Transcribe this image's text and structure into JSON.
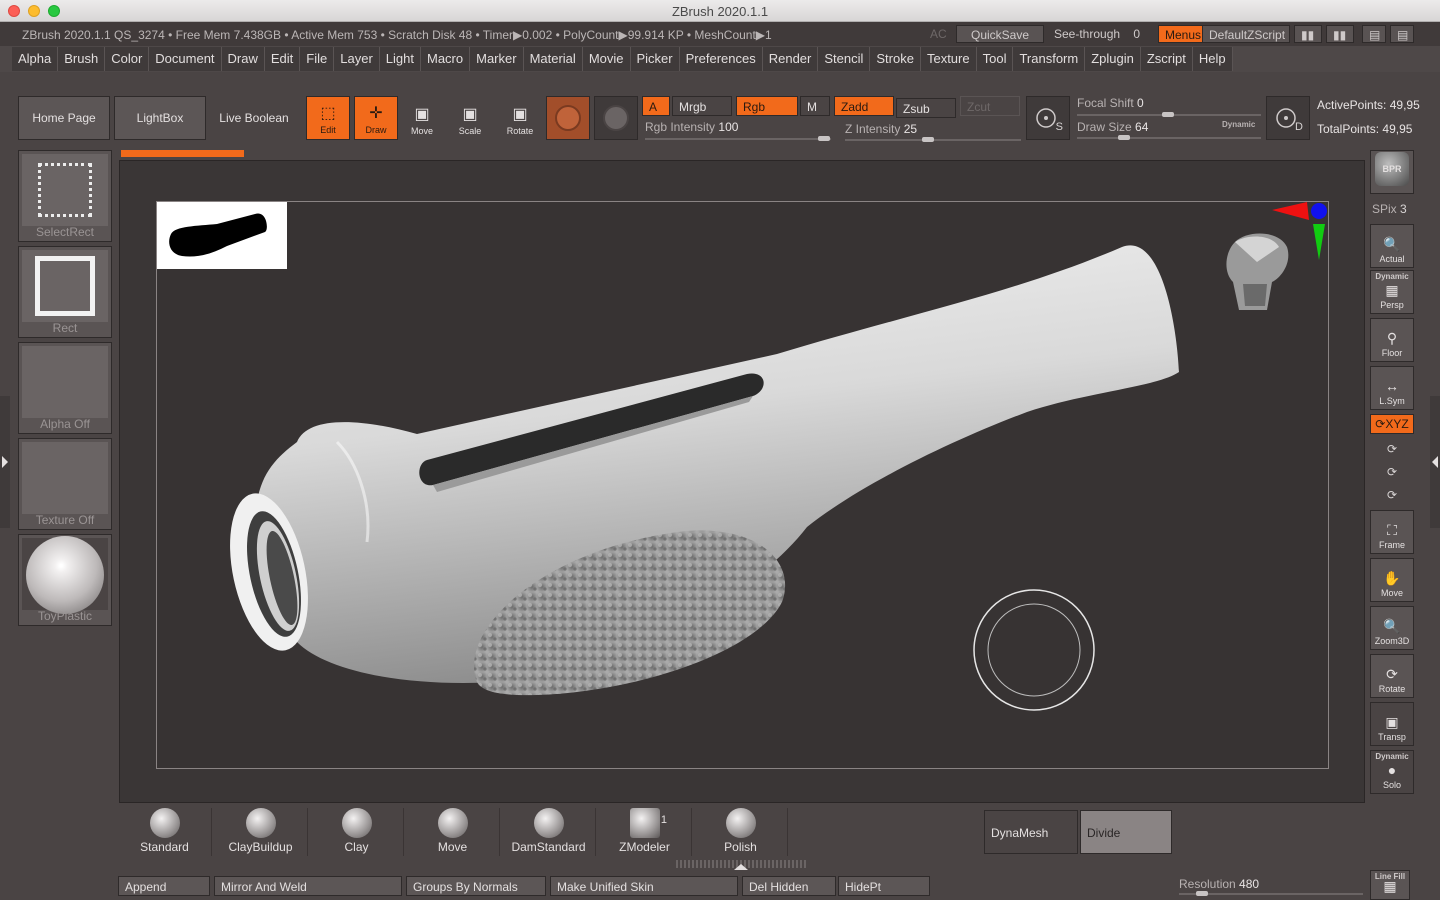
{
  "window": {
    "title": "ZBrush 2020.1.1"
  },
  "infobar": {
    "text": "ZBrush 2020.1.1 QS_3274     • Free Mem 7.438GB • Active Mem 753 • Scratch Disk 48 •   Timer▶0.002 • PolyCount▶99.914 KP  • MeshCount▶1",
    "ac_label": "AC",
    "quicksave": "QuickSave",
    "seethrough_label": "See-through",
    "seethrough_value": "0",
    "menus": "Menus",
    "defaultzscript": "DefaultZScript"
  },
  "menubar": [
    "Alpha",
    "Brush",
    "Color",
    "Document",
    "Draw",
    "Edit",
    "File",
    "Layer",
    "Light",
    "Macro",
    "Marker",
    "Material",
    "Movie",
    "Picker",
    "Preferences",
    "Render",
    "Stencil",
    "Stroke",
    "Texture",
    "Tool",
    "Transform",
    "Zplugin",
    "Zscript",
    "Help"
  ],
  "shelf": {
    "home_page": "Home Page",
    "lightbox": "LightBox",
    "live_boolean": "Live Boolean",
    "edit": "Edit",
    "draw": "Draw",
    "move": "Move",
    "scale": "Scale",
    "rotate": "Rotate",
    "a": "A",
    "mrgb": "Mrgb",
    "rgb": "Rgb",
    "m": "M",
    "zadd": "Zadd",
    "zsub": "Zsub",
    "zcut": "Zcut",
    "rgb_intensity_label": "Rgb Intensity",
    "rgb_intensity_value": "100",
    "z_intensity_label": "Z Intensity",
    "z_intensity_value": "25",
    "focal_shift_label": "Focal Shift",
    "focal_shift_value": "0",
    "draw_size_label": "Draw Size",
    "draw_size_value": "64",
    "dynamic": "Dynamic",
    "active_points_label": "ActivePoints:",
    "active_points_value": "49,95",
    "total_points_label": "TotalPoints:",
    "total_points_value": "49,95",
    "s_letter": "S",
    "d_letter": "D"
  },
  "left_panel": [
    "SelectRect",
    "Rect",
    "Alpha Off",
    "Texture Off",
    "ToyPlastic"
  ],
  "right_panel": {
    "bpr": "BPR",
    "spix_label": "SPix",
    "spix_value": "3",
    "actual": "Actual",
    "persp": "Persp",
    "dynamic": "Dynamic",
    "floor": "Floor",
    "lsym": "L.Sym",
    "xyz": "XYZ",
    "frame": "Frame",
    "move": "Move",
    "zoom3d": "Zoom3D",
    "rotate": "Rotate",
    "transp": "Transp",
    "solo": "Solo",
    "line_fill": "Line Fill"
  },
  "brushes": [
    "Standard",
    "ClayBuildup",
    "Clay",
    "Move",
    "DamStandard",
    "ZModeler",
    "Polish"
  ],
  "zmodeler_badge": "1",
  "bottom": {
    "append": "Append",
    "mirror_weld": "Mirror And Weld",
    "groups_normals": "Groups By Normals",
    "unified_skin": "Make Unified Skin",
    "del_hidden": "Del Hidden",
    "hidept": "HidePt",
    "dynamesh": "DynaMesh",
    "divide": "Divide",
    "resolution_label": "Resolution",
    "resolution_value": "480"
  },
  "colors": {
    "accent": "#f26a1b",
    "background": "#4a4444",
    "viewport": "#373333"
  }
}
